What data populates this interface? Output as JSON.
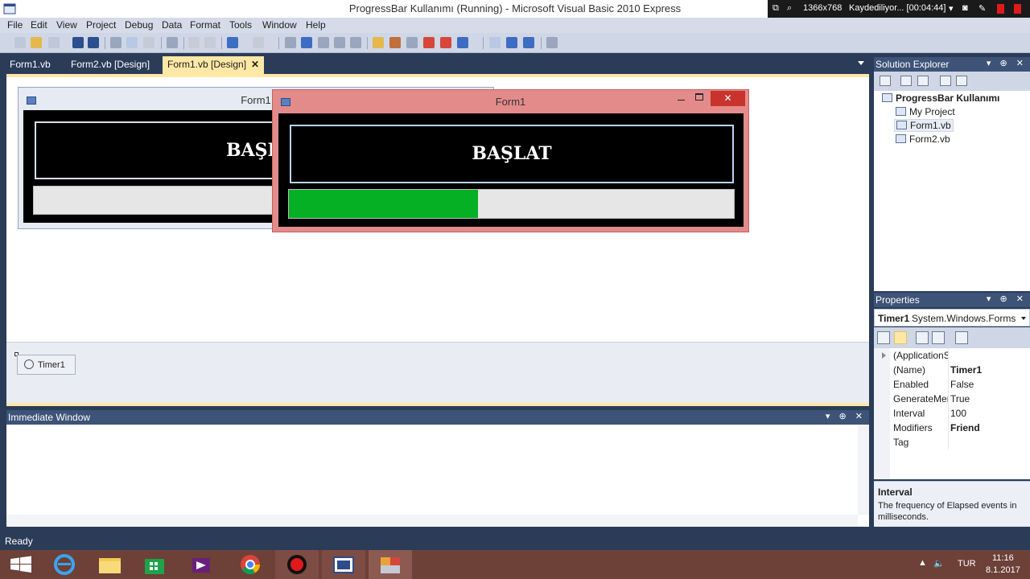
{
  "window": {
    "title": "ProgressBar Kullanımı (Running) - Microsoft Visual Basic 2010 Express"
  },
  "recorder": {
    "resolution": "1366x768",
    "status": "Kaydediliyor... [00:04:44]"
  },
  "menu": {
    "items": [
      "File",
      "Edit",
      "View",
      "Project",
      "Debug",
      "Data",
      "Format",
      "Tools",
      "Window",
      "Help"
    ]
  },
  "doc_tabs": {
    "tab1": "Form1.vb",
    "tab2": "Form2.vb [Design]",
    "tab3": "Form1.vb [Design]",
    "close": "✕"
  },
  "design_form": {
    "title": "Form1",
    "button_label": "BAŞLA"
  },
  "running_form": {
    "title": "Form1",
    "button_label": "BAŞLAT",
    "close_glyph": "✕",
    "progress_fraction": 0.425,
    "progress_color": "#06b025"
  },
  "tray": {
    "timer_label": "Timer1"
  },
  "immediate": {
    "title": "Immediate Window",
    "controls": "▾ ⊕ ✕"
  },
  "solution_explorer": {
    "title": "Solution Explorer",
    "controls": "▾ ⊕ ✕",
    "project": "ProgressBar Kullanımı",
    "items": [
      "My Project",
      "Form1.vb",
      "Form2.vb"
    ]
  },
  "properties": {
    "title": "Properties",
    "controls": "▾ ⊕ ✕",
    "object_name": "Timer1",
    "object_type": "System.Windows.Forms.Ti",
    "rows": [
      {
        "key": "(ApplicationS",
        "value": ""
      },
      {
        "key": "(Name)",
        "value": "Timer1"
      },
      {
        "key": "Enabled",
        "value": "False"
      },
      {
        "key": "GenerateMen",
        "value": "True"
      },
      {
        "key": "Interval",
        "value": "100"
      },
      {
        "key": "Modifiers",
        "value": "Friend"
      },
      {
        "key": "Tag",
        "value": ""
      }
    ],
    "desc_title": "Interval",
    "desc_text": "The frequency of Elapsed events in milliseconds."
  },
  "status": {
    "text": "Ready"
  },
  "taskbar": {
    "lang": "TUR",
    "time": "11:16",
    "date": "8.1.2017"
  },
  "colors": {
    "ide_dark": "#2b3c59",
    "tab_active": "#ffe8a6",
    "taskbar": "#6d4038"
  }
}
